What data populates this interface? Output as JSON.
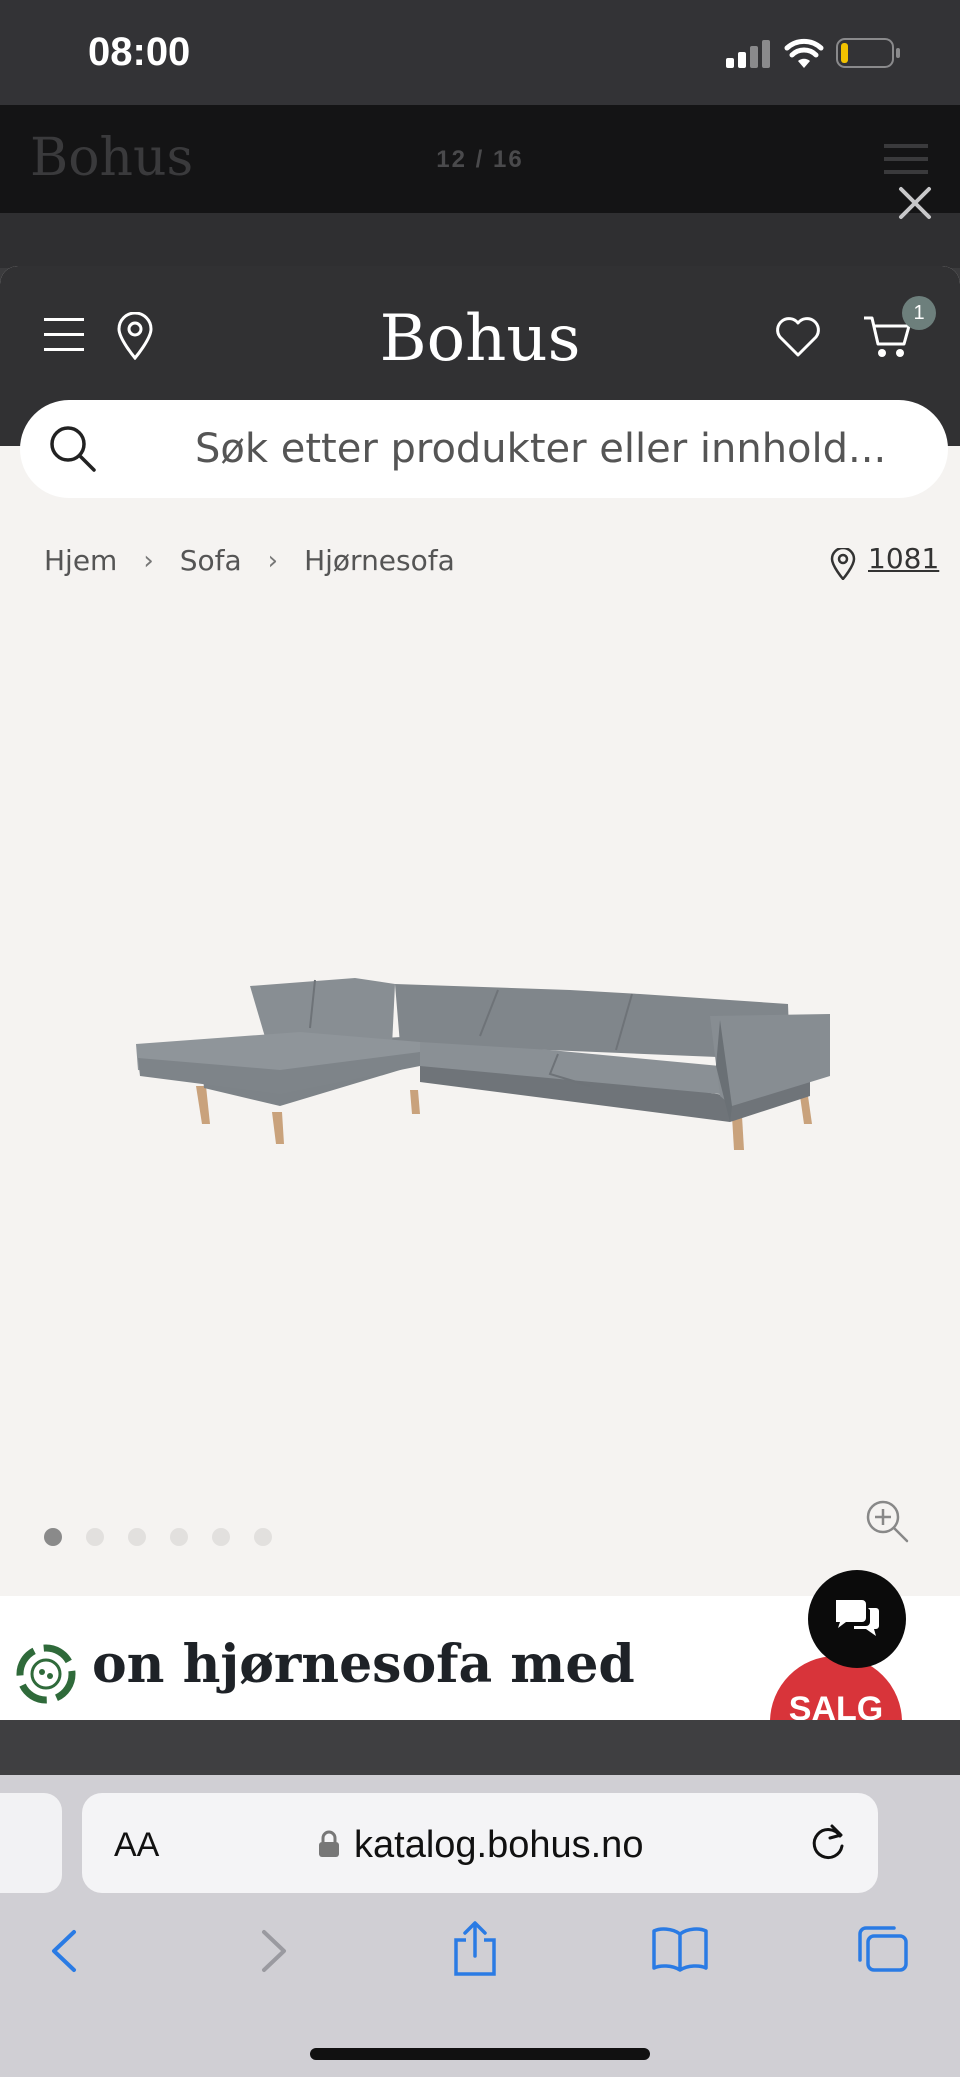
{
  "status_bar": {
    "time": "08:00"
  },
  "viewer": {
    "logo": "Bohus",
    "page_indicator": "12 / 16"
  },
  "header": {
    "brand": "Bohus",
    "cart_count": "1"
  },
  "search": {
    "placeholder": "Søk etter produkter eller innhold..."
  },
  "breadcrumb": {
    "items": [
      "Hjem",
      "Sofa",
      "Hjørnesofa"
    ],
    "postal_code": "1081"
  },
  "gallery": {
    "dot_count": 6,
    "active_index": 0
  },
  "promo": {
    "text": "on hjørnesofa med",
    "sale_badge": "SALG"
  },
  "browser": {
    "text_size_label": "AA",
    "url": "katalog.bohus.no"
  },
  "colors": {
    "header_bg": "#313133",
    "page_bg": "#f5f3f1",
    "sale_red": "#d8343a",
    "cart_badge": "#6d7f7c"
  }
}
